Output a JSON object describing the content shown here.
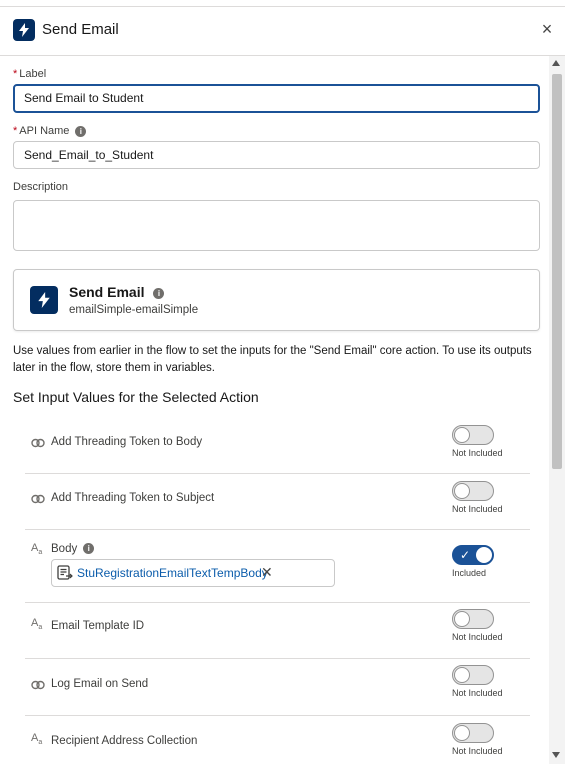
{
  "header": {
    "title": "Send Email",
    "close_glyph": "×",
    "icon": "lightning-bolt-icon"
  },
  "form": {
    "label_label": "Label",
    "label_value": "Send Email to Student",
    "api_label": "API Name",
    "api_value": "Send_Email_to_Student",
    "description_label": "Description",
    "description_value": "",
    "required_mark": "*"
  },
  "action_card": {
    "title": "Send Email",
    "subtitle": "emailSimple-emailSimple",
    "icon": "lightning-bolt-icon"
  },
  "help_text": "Use values from earlier in the flow to set the inputs for the \"Send Email\" core action. To use its outputs later in the flow, store them in variables.",
  "section_title": "Set Input Values for the Selected Action",
  "inputs": [
    {
      "label": "Add Threading Token to Body",
      "icon": "boolean-icon",
      "state": "Not Included",
      "on": false
    },
    {
      "label": "Add Threading Token to Subject",
      "icon": "boolean-icon",
      "state": "Not Included",
      "on": false
    },
    {
      "label": "Body",
      "icon": "text-icon",
      "state": "Included",
      "on": true,
      "value": "StuRegistrationEmailTextTempBody",
      "value_remove": "✕"
    },
    {
      "label": "Email Template ID",
      "icon": "text-icon",
      "state": "Not Included",
      "on": false
    },
    {
      "label": "Log Email on Send",
      "icon": "boolean-icon",
      "state": "Not Included",
      "on": false
    },
    {
      "label": "Recipient Address Collection",
      "icon": "text-icon",
      "state": "Not Included",
      "on": false
    }
  ],
  "info_glyph": "i",
  "text_icon_glyph": "A",
  "text_icon_sub": "a",
  "colors": {
    "brand": "#032d60",
    "toggle_on": "#1b5297",
    "link": "#0b5cab",
    "required": "#ba0517"
  }
}
